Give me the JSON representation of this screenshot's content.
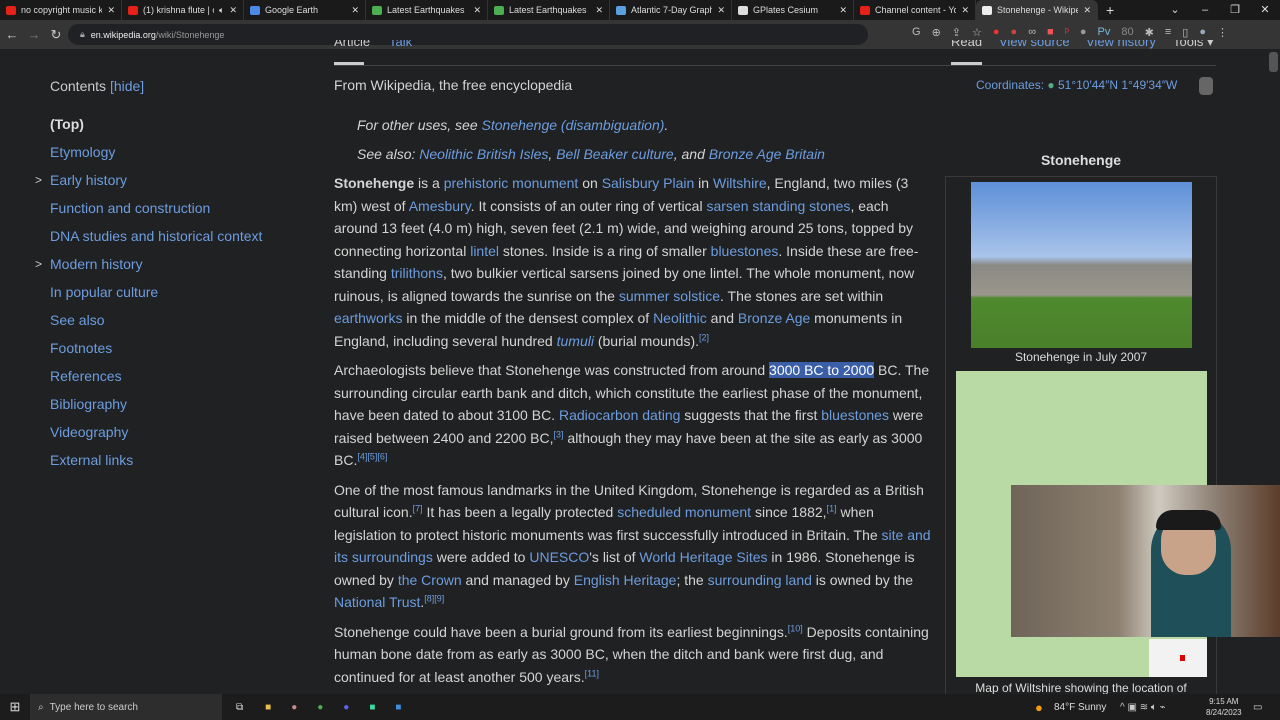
{
  "browser": {
    "tabs": [
      {
        "title": "no copyright music kr",
        "icon": "youtube-icon",
        "color": "#e62117"
      },
      {
        "title": "(1) krishna flute | c",
        "icon": "youtube-icon",
        "color": "#e62117",
        "audio": true
      },
      {
        "title": "Google Earth",
        "icon": "google-earth-icon",
        "color": "#4a8ae8"
      },
      {
        "title": "Latest Earthquakes",
        "icon": "usgs-icon",
        "color": "#4caf50"
      },
      {
        "title": "Latest Earthquakes",
        "icon": "usgs-icon",
        "color": "#4caf50"
      },
      {
        "title": "Atlantic 7-Day Graphic",
        "icon": "noaa-icon",
        "color": "#5aa0e0"
      },
      {
        "title": "GPlates Cesium",
        "icon": "gplates-icon",
        "color": "#dddddd"
      },
      {
        "title": "Channel content - You",
        "icon": "youtube-icon",
        "color": "#e62117"
      },
      {
        "title": "Stonehenge - Wikiped",
        "icon": "wikipedia-icon",
        "color": "#eeeeee",
        "active": true
      }
    ],
    "url_host": "en.wikipedia.org",
    "url_path": "/wiki/Stonehenge",
    "ext_badge": "80",
    "ext_pv": "Pv"
  },
  "page_tabs": {
    "article": "Article",
    "talk": "Talk",
    "read": "Read",
    "view_source": "View source",
    "view_history": "View history",
    "tools": "Tools ▾"
  },
  "coordinates": {
    "label": "Coordinates:",
    "value": "51°10′44″N 1°49′34″W"
  },
  "toc": {
    "title": "Contents",
    "hide": "[hide]",
    "items": [
      {
        "label": "(Top)",
        "top": true
      },
      {
        "label": "Etymology"
      },
      {
        "label": "Early history",
        "expand": true
      },
      {
        "label": "Function and construction"
      },
      {
        "label": "DNA studies and historical context"
      },
      {
        "label": "Modern history",
        "expand": true
      },
      {
        "label": "In popular culture"
      },
      {
        "label": "See also"
      },
      {
        "label": "Footnotes"
      },
      {
        "label": "References"
      },
      {
        "label": "Bibliography"
      },
      {
        "label": "Videography"
      },
      {
        "label": "External links"
      }
    ]
  },
  "article": {
    "tagline": "From Wikipedia, the free encyclopedia",
    "hatnotes": [
      [
        {
          "t": "For other uses, see "
        },
        {
          "t": "Stonehenge (disambiguation)",
          "l": 1
        },
        {
          "t": "."
        }
      ],
      [
        {
          "t": "See also: "
        },
        {
          "t": "Neolithic British Isles",
          "l": 1
        },
        {
          "t": ", "
        },
        {
          "t": "Bell Beaker culture",
          "l": 1
        },
        {
          "t": ", and "
        },
        {
          "t": "Bronze Age Britain",
          "l": 1
        }
      ]
    ],
    "paragraphs": [
      [
        {
          "t": "Stonehenge",
          "b": 1
        },
        {
          "t": " is a "
        },
        {
          "t": "prehistoric monument",
          "l": 1
        },
        {
          "t": " on "
        },
        {
          "t": "Salisbury Plain",
          "l": 1
        },
        {
          "t": " in "
        },
        {
          "t": "Wiltshire",
          "l": 1
        },
        {
          "t": ", England, two miles (3 km) west of "
        },
        {
          "t": "Amesbury",
          "l": 1
        },
        {
          "t": ". It consists of an outer ring of vertical "
        },
        {
          "t": "sarsen standing stones",
          "l": 1
        },
        {
          "t": ", each around 13 feet (4.0 m) high, seven feet (2.1 m) wide, and weighing around 25 tons, topped by connecting horizontal "
        },
        {
          "t": "lintel",
          "l": 1
        },
        {
          "t": " stones. Inside is a ring of smaller "
        },
        {
          "t": "bluestones",
          "l": 1
        },
        {
          "t": ". Inside these are free-standing "
        },
        {
          "t": "trilithons",
          "l": 1
        },
        {
          "t": ", two bulkier vertical sarsens joined by one lintel. The whole monument, now ruinous, is aligned towards the sunrise on the "
        },
        {
          "t": "summer solstice",
          "l": 1
        },
        {
          "t": ". The stones are set within "
        },
        {
          "t": "earthworks",
          "l": 1
        },
        {
          "t": " in the middle of the densest complex of "
        },
        {
          "t": "Neolithic",
          "l": 1
        },
        {
          "t": " and "
        },
        {
          "t": "Bronze Age",
          "l": 1
        },
        {
          "t": " monuments in England, including several hundred "
        },
        {
          "t": "tumuli",
          "l": 1,
          "i": 1
        },
        {
          "t": " (burial mounds)."
        },
        {
          "t": "[2]",
          "s": 1
        }
      ],
      [
        {
          "t": "Archaeologists believe that Stonehenge was constructed from around "
        },
        {
          "t": "3000 BC to 2000",
          "h": 1
        },
        {
          "t": " BC. The surrounding circular earth bank and ditch, which constitute the earliest phase of the monument, have been dated to about 3100 BC. "
        },
        {
          "t": "Radiocarbon dating",
          "l": 1
        },
        {
          "t": " suggests that the first "
        },
        {
          "t": "bluestones",
          "l": 1
        },
        {
          "t": " were raised between 2400 and 2200 BC,"
        },
        {
          "t": "[3]",
          "s": 1
        },
        {
          "t": " although they may have been at the site as early as 3000 BC."
        },
        {
          "t": "[4][5][6]",
          "s": 1
        }
      ],
      [
        {
          "t": "One of the most famous landmarks in the United Kingdom, Stonehenge is regarded as a British cultural icon."
        },
        {
          "t": "[7]",
          "s": 1
        },
        {
          "t": " It has been a legally protected "
        },
        {
          "t": "scheduled monument",
          "l": 1
        },
        {
          "t": " since 1882,"
        },
        {
          "t": "[1]",
          "s": 1
        },
        {
          "t": " when legislation to protect historic monuments was first successfully introduced in Britain. The "
        },
        {
          "t": "site and its surroundings",
          "l": 1
        },
        {
          "t": " were added to "
        },
        {
          "t": "UNESCO",
          "l": 1
        },
        {
          "t": "'s list of "
        },
        {
          "t": "World Heritage Sites",
          "l": 1
        },
        {
          "t": " in 1986. Stonehenge is owned by "
        },
        {
          "t": "the Crown",
          "l": 1
        },
        {
          "t": " and managed by "
        },
        {
          "t": "English Heritage",
          "l": 1
        },
        {
          "t": "; the "
        },
        {
          "t": "surrounding land",
          "l": 1
        },
        {
          "t": " is owned by the "
        },
        {
          "t": "National Trust",
          "l": 1
        },
        {
          "t": ".",
          "x": 1
        },
        {
          "t": "[8][9]",
          "s": 1
        }
      ],
      [
        {
          "t": "Stonehenge could have been a burial ground from its earliest beginnings."
        },
        {
          "t": "[10]",
          "s": 1
        },
        {
          "t": " Deposits containing human bone date from as early as 3000 BC, when the ditch and bank were first dug, and continued for at least another 500 years."
        },
        {
          "t": "[11]",
          "s": 1
        }
      ]
    ]
  },
  "infobox": {
    "title": "Stonehenge",
    "image_caption": "Stonehenge in July 2007",
    "map_caption": "Map of Wiltshire showing the location of"
  },
  "taskbar": {
    "search_placeholder": "Type here to search",
    "weather": "84°F  Sunny",
    "time": "9:15 AM",
    "date": "8/24/2023"
  }
}
